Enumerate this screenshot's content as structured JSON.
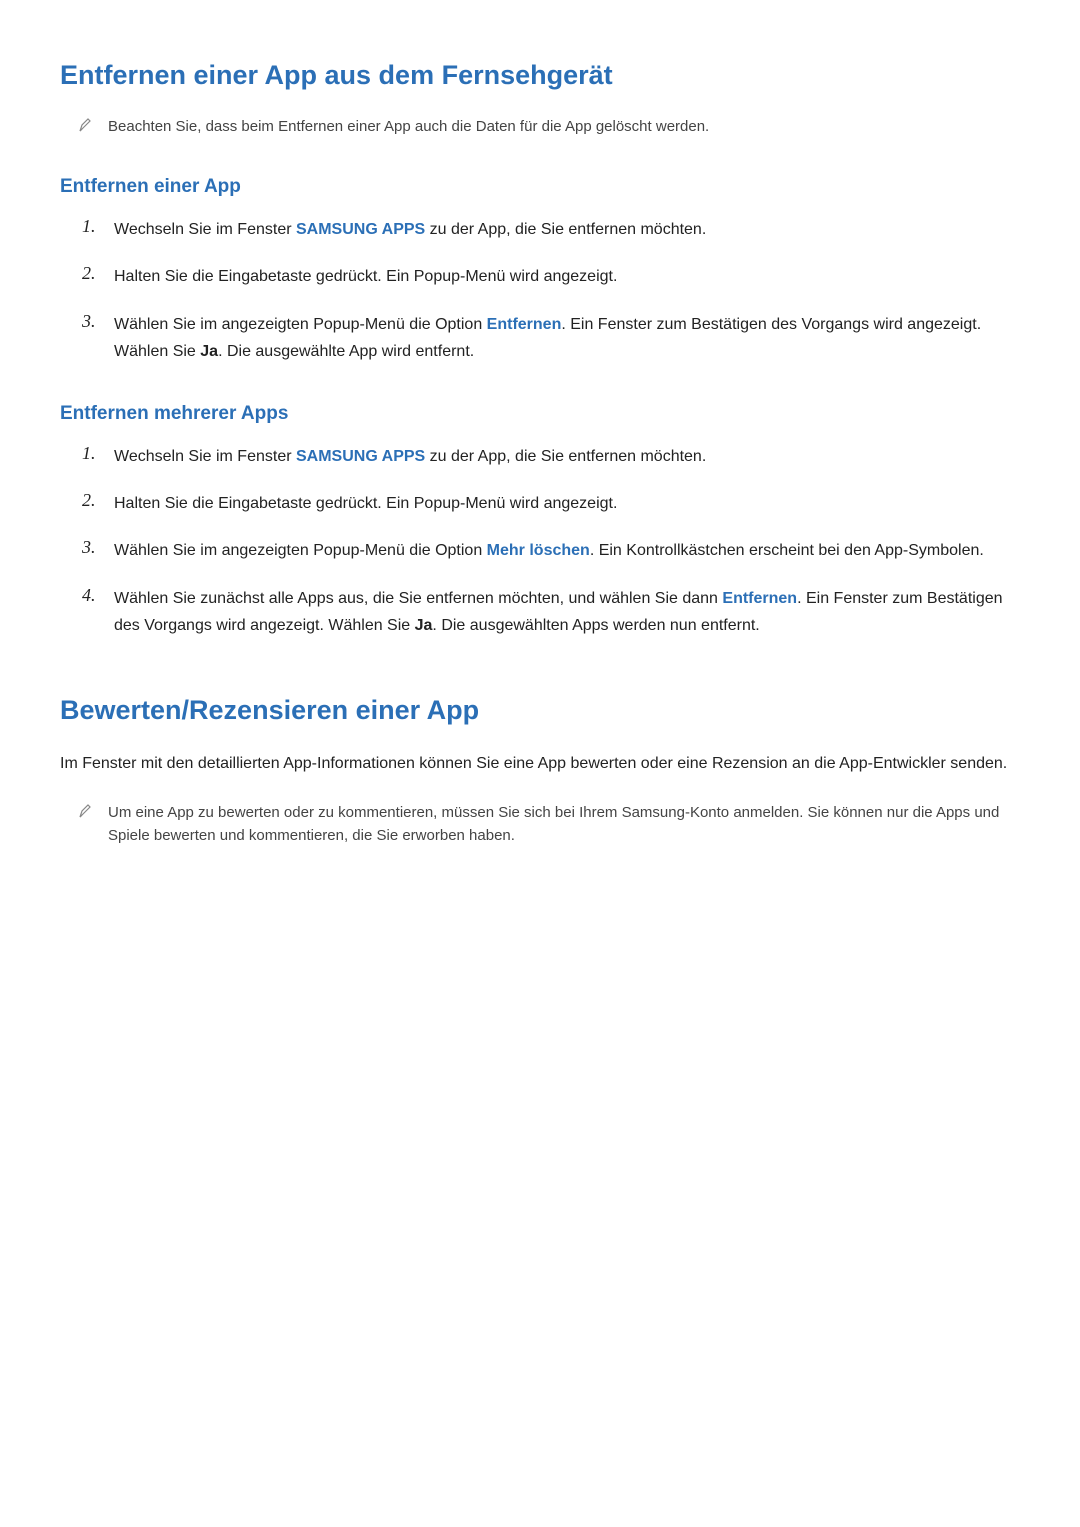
{
  "section1": {
    "title": "Entfernen einer App aus dem Fernsehgerät",
    "note": "Beachten Sie, dass beim Entfernen einer App auch die Daten für die App gelöscht werden.",
    "sub1": {
      "title": "Entfernen einer App",
      "steps": [
        {
          "pre": "Wechseln Sie im Fenster ",
          "kw1": "SAMSUNG APPS",
          "post": " zu der App, die Sie entfernen möchten."
        },
        {
          "full": "Halten Sie die Eingabetaste gedrückt. Ein Popup-Menü wird angezeigt."
        },
        {
          "pre": "Wählen Sie im angezeigten Popup-Menü die Option ",
          "kw1": "Entfernen",
          "mid": ". Ein Fenster zum Bestätigen des Vorgangs wird angezeigt. Wählen Sie ",
          "kw2": "Ja",
          "post": ". Die ausgewählte App wird entfernt."
        }
      ]
    },
    "sub2": {
      "title": "Entfernen mehrerer Apps",
      "steps": [
        {
          "pre": "Wechseln Sie im Fenster ",
          "kw1": "SAMSUNG APPS",
          "post": " zu der App, die Sie entfernen möchten."
        },
        {
          "full": "Halten Sie die Eingabetaste gedrückt. Ein Popup-Menü wird angezeigt."
        },
        {
          "pre": "Wählen Sie im angezeigten Popup-Menü die Option ",
          "kw1": "Mehr löschen",
          "post": ". Ein Kontrollkästchen erscheint bei den App-Symbolen."
        },
        {
          "pre": "Wählen Sie zunächst alle Apps aus, die Sie entfernen möchten, und wählen Sie dann ",
          "kw1": "Entfernen",
          "mid": ". Ein Fenster zum Bestätigen des Vorgangs wird angezeigt. Wählen Sie ",
          "kw2": "Ja",
          "post": ". Die ausgewählten Apps werden nun entfernt."
        }
      ]
    }
  },
  "section2": {
    "title": "Bewerten/Rezensieren einer App",
    "para": "Im Fenster mit den detaillierten App-Informationen können Sie eine App bewerten oder eine Rezension an die App-Entwickler senden.",
    "note": "Um eine App zu bewerten oder zu kommentieren, müssen Sie sich bei Ihrem Samsung-Konto anmelden. Sie können nur die Apps und Spiele bewerten und kommentieren, die Sie erworben haben."
  }
}
